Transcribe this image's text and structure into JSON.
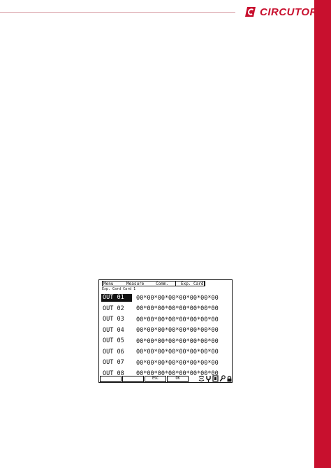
{
  "brand": {
    "name": "CIRCUTOR",
    "color": "#c8102e"
  },
  "lcd": {
    "menu": {
      "items": [
        "Menu",
        "Measure",
        "Comm.",
        "Exp. Card"
      ],
      "active": "Exp. Card"
    },
    "subtitle": "Exp. Card Card 1",
    "rows": [
      {
        "label": "OUT 01",
        "value": "00*00*00*00*00*00*00*00",
        "selected": true
      },
      {
        "label": "OUT 02",
        "value": "00*00*00*00*00*00*00*00"
      },
      {
        "label": "OUT 03",
        "value": "00*00*00*00*00*00*00*00"
      },
      {
        "label": "OUT 04",
        "value": "00*00*00*00*00*00*00*00"
      },
      {
        "label": "OUT 05",
        "value": "00*00*00*00*00*00*00*00"
      },
      {
        "label": "OUT 06",
        "value": "00*00*00*00*00*00*00*00"
      },
      {
        "label": "OUT 07",
        "value": "00*00*00*00*00*00*00*00"
      },
      {
        "label": "OUT 08",
        "value": "00*00*00*00*00*00*00*00"
      }
    ],
    "softkeys": [
      "",
      "",
      "ESC",
      "OK"
    ],
    "status_icons": [
      "link-icon",
      "plug-icon",
      "memory-icon",
      "wrench-icon",
      "lock-icon"
    ]
  }
}
